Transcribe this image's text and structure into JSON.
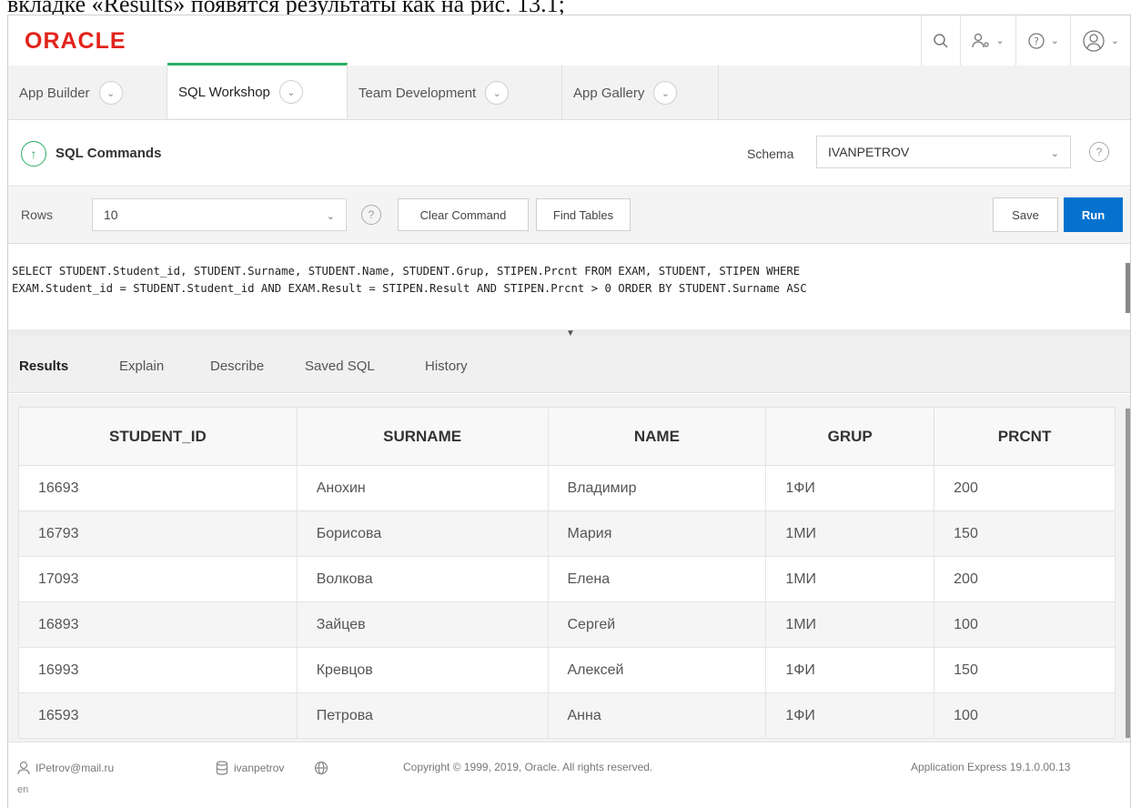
{
  "caption": "вкладке «Results» появятся результаты как на рис. 13.1;",
  "brand": {
    "logo_text": "ORACLE",
    "logo_color": "#e2231a"
  },
  "nav": {
    "tabs": [
      {
        "label": "App Builder"
      },
      {
        "label": "SQL Workshop"
      },
      {
        "label": "Team Development"
      },
      {
        "label": "App Gallery"
      }
    ],
    "active_tab": "SQL Workshop"
  },
  "header": {
    "icons": [
      "search-icon",
      "user-admin-icon",
      "help-icon",
      "account-icon"
    ],
    "title": "SQL Commands",
    "schema_label": "Schema",
    "schema_value": "IVANPETROV"
  },
  "toolbar": {
    "rows_label": "Rows",
    "rows_value": "10",
    "clear_label": "Clear Command",
    "find_label": "Find Tables",
    "save_label": "Save",
    "run_label": "Run",
    "accent": "#0572ce"
  },
  "editor": {
    "lines": [
      "SELECT STUDENT.Student_id, STUDENT.Surname, STUDENT.Name, STUDENT.Grup, STIPEN.Prcnt FROM EXAM, STUDENT, STIPEN WHERE",
      "EXAM.Student_id = STUDENT.Student_id AND EXAM.Result = STIPEN.Result AND STIPEN.Prcnt > 0 ORDER BY STUDENT.Surname ASC"
    ]
  },
  "results_tabs": [
    "Results",
    "Explain",
    "Describe",
    "Saved SQL",
    "History"
  ],
  "table": {
    "headers": [
      "STUDENT_ID",
      "SURNAME",
      "NAME",
      "GRUP",
      "PRCNT"
    ],
    "rows": [
      [
        "16693",
        "Анохин",
        "Владимир",
        "1ФИ",
        "200"
      ],
      [
        "16793",
        "Борисова",
        "Мария",
        "1МИ",
        "150"
      ],
      [
        "17093",
        "Волкова",
        "Елена",
        "1МИ",
        "200"
      ],
      [
        "16893",
        "Зайцев",
        "Сергей",
        "1МИ",
        "100"
      ],
      [
        "16993",
        "Кревцов",
        "Алексей",
        "1ФИ",
        "150"
      ],
      [
        "16593",
        "Петрова",
        "Анна",
        "1ФИ",
        "100"
      ]
    ]
  },
  "footer": {
    "user": "IPetrov@mail.ru",
    "workspace": "ivanpetrov",
    "copyright": "Copyright © 1999, 2019, Oracle. All rights reserved.",
    "version": "Application Express 19.1.0.00.13",
    "lang": "en"
  }
}
